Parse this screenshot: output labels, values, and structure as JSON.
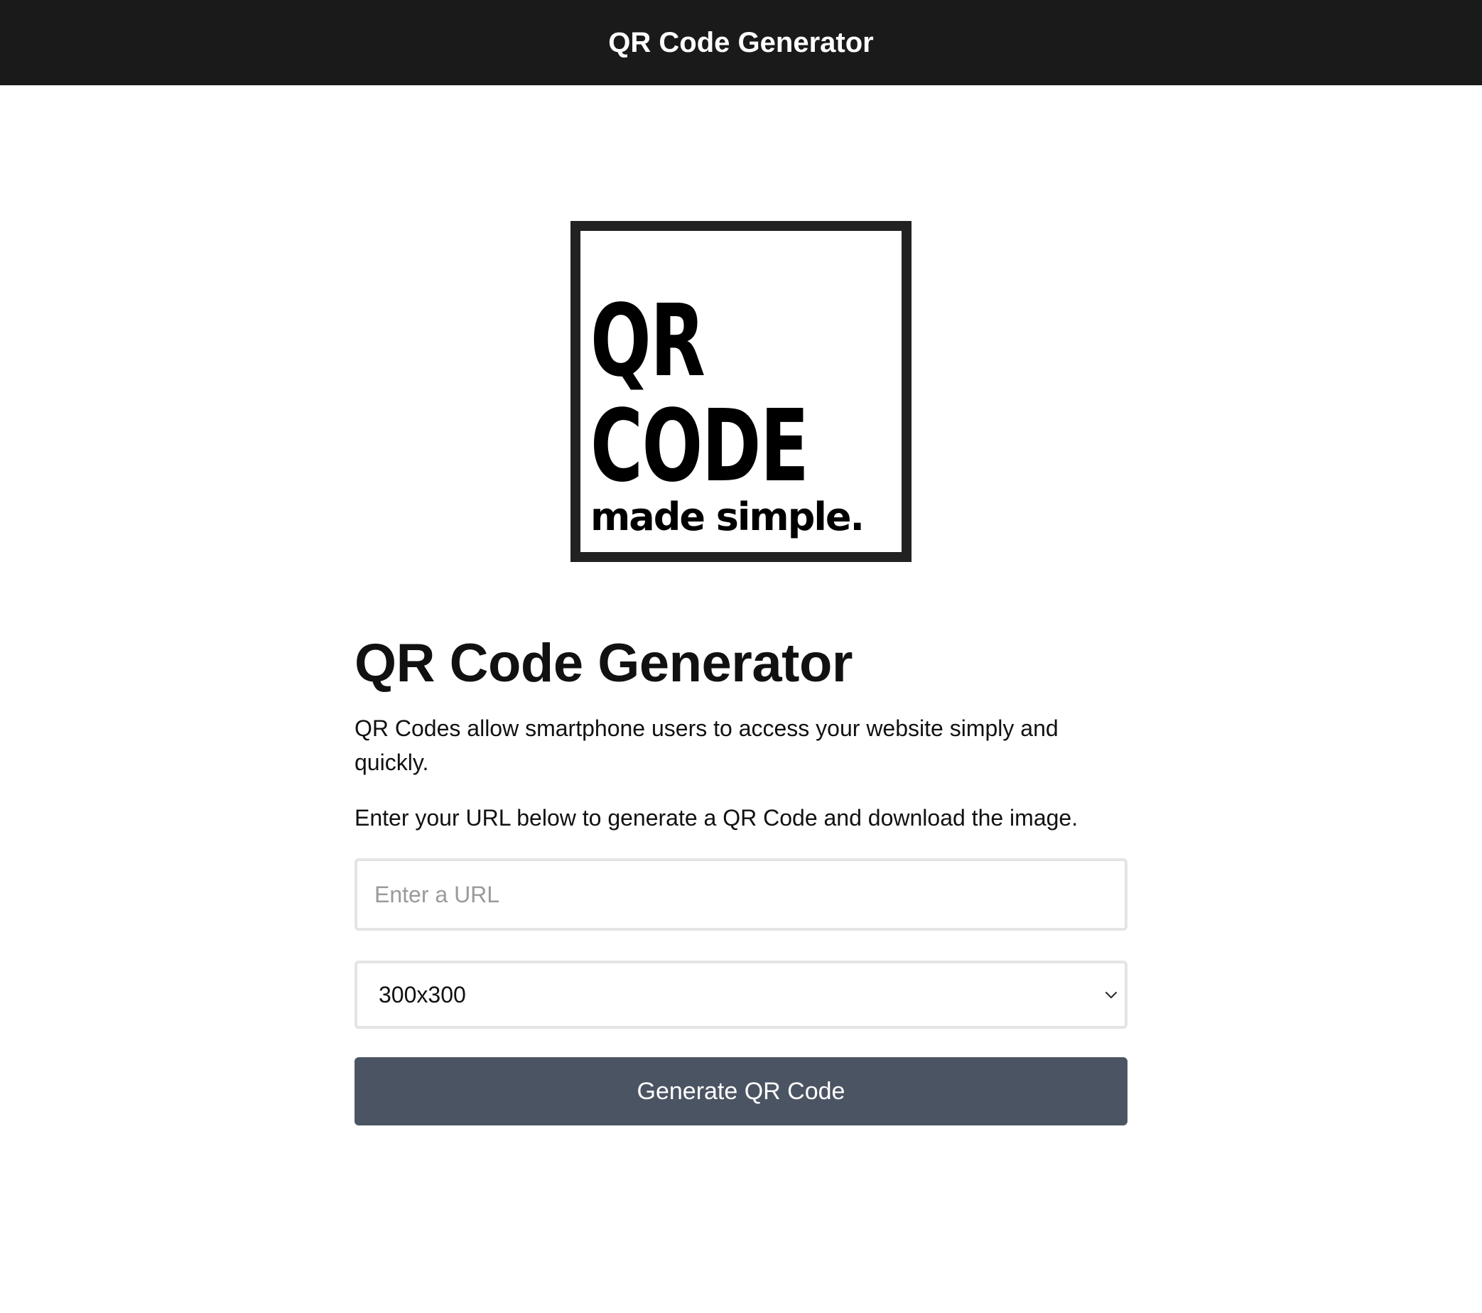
{
  "header": {
    "title": "QR Code Generator"
  },
  "logo": {
    "line1": "QR",
    "line2": "CODE",
    "tagline": "made simple."
  },
  "main": {
    "heading": "QR Code Generator",
    "description": "QR Codes allow smartphone users to access your website simply and quickly.",
    "instruction": "Enter your URL below to generate a QR Code and download the image.",
    "url_input": {
      "value": "",
      "placeholder": "Enter a URL"
    },
    "size_select": {
      "selected": "300x300",
      "icon": "chevron-down-icon"
    },
    "generate_button": "Generate QR Code"
  },
  "colors": {
    "topbar_bg": "#1a1a1a",
    "button_bg": "#4b5462",
    "input_border": "#e4e4e4"
  }
}
